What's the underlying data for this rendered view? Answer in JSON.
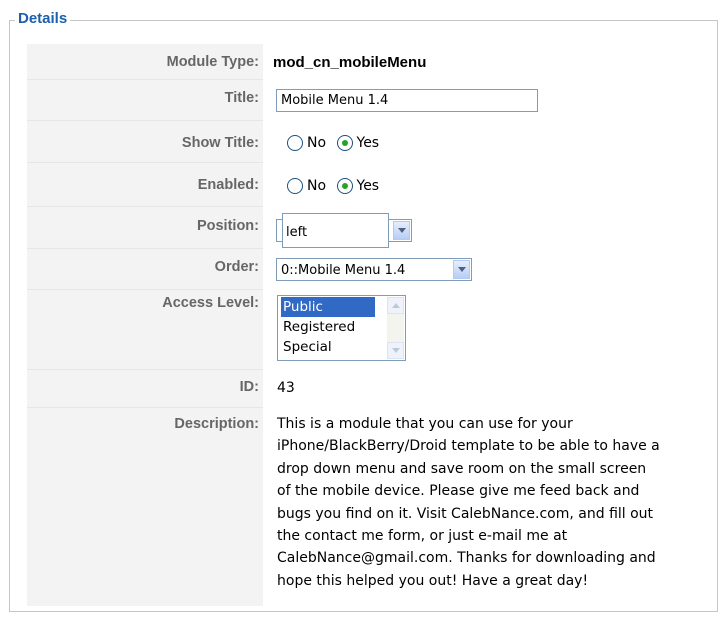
{
  "fieldset": {
    "legend": "Details"
  },
  "fields": {
    "module_type": {
      "label": "Module Type:",
      "value": "mod_cn_mobileMenu"
    },
    "title": {
      "label": "Title:",
      "value": "Mobile Menu 1.4"
    },
    "show_title": {
      "label": "Show Title:",
      "no_label": "No",
      "yes_label": "Yes",
      "selected": "Yes"
    },
    "enabled": {
      "label": "Enabled:",
      "no_label": "No",
      "yes_label": "Yes",
      "selected": "Yes"
    },
    "position": {
      "label": "Position:",
      "value": "left"
    },
    "order": {
      "label": "Order:",
      "value": "0::Mobile Menu 1.4"
    },
    "access_level": {
      "label": "Access Level:",
      "options": [
        "Public",
        "Registered",
        "Special"
      ],
      "selected": "Public"
    },
    "id": {
      "label": "ID:",
      "value": "43"
    },
    "description": {
      "label": "Description:",
      "lines": [
        "This is a module that you can use for your",
        "iPhone/BlackBerry/Droid template to be able to have a",
        "drop down menu and save room on the small screen",
        "of the mobile device. Please give me feed back and",
        "bugs you find on it. Visit CalebNance.com, and fill out",
        "the contact me form, or just e-mail me at",
        "CalebNance@gmail.com. Thanks for downloading and",
        "hope this helped you out! Have a great day!"
      ]
    }
  },
  "colors": {
    "legend": "#1b60ad",
    "label_bg": "#f3f3f3",
    "label_text": "#666666",
    "selected_option": "#316ac5",
    "radio_dot": "#23a423"
  }
}
